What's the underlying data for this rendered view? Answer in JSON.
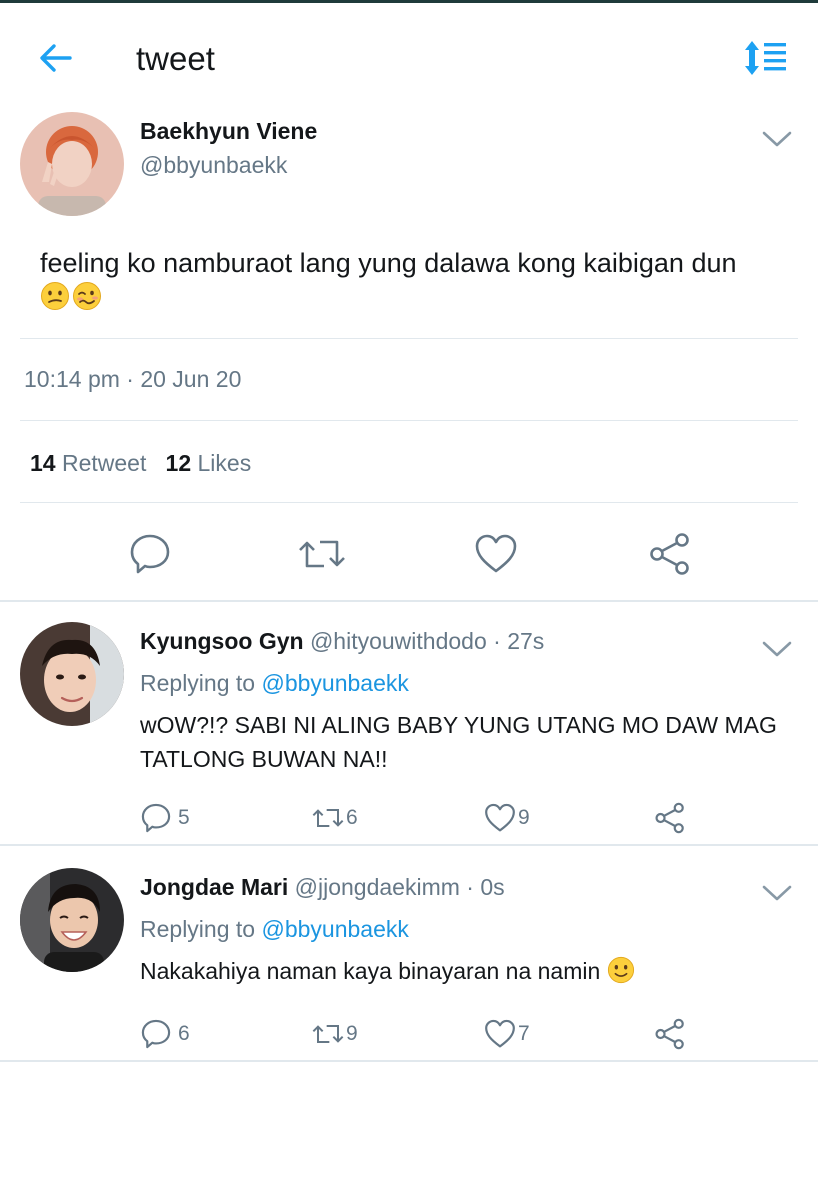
{
  "header": {
    "title": "tweet",
    "back_icon": "arrow-left-icon",
    "sort_icon": "sort-list-icon",
    "accent": "#1da1f2"
  },
  "tweet": {
    "author_name": "Baekhyun Viene",
    "author_handle": "@bbyunbaekk",
    "text": "feeling ko namburaot lang yung dalawa kong kaibigan dun",
    "emojis": [
      "confused-face-emoji",
      "woozy-face-emoji"
    ],
    "timestamp": "10:14 pm · 20 Jun 20",
    "retweet_count": "14",
    "retweet_label": "Retweet",
    "like_count": "12",
    "like_label": "Likes"
  },
  "replies": [
    {
      "name": "Kyungsoo Gyn",
      "handle": "@hityouwithdodo",
      "time": "· 27s",
      "replying_prefix": "Replying to",
      "replying_to": "@bbyunbaekk",
      "text": "wOW?!? SABI NI ALING BABY YUNG UTANG MO DAW MAG TATLONG BUWAN NA!!",
      "reply_count": "5",
      "retweet_count": "6",
      "like_count": "9"
    },
    {
      "name": "Jongdae Mari",
      "handle": "@jjongdaekimm",
      "time": "· 0s",
      "replying_prefix": "Replying to",
      "replying_to": "@bbyunbaekk",
      "text": "Nakakahiya naman kaya binayaran na namin",
      "reply_count": "6",
      "retweet_count": "9",
      "like_count": "7"
    }
  ]
}
